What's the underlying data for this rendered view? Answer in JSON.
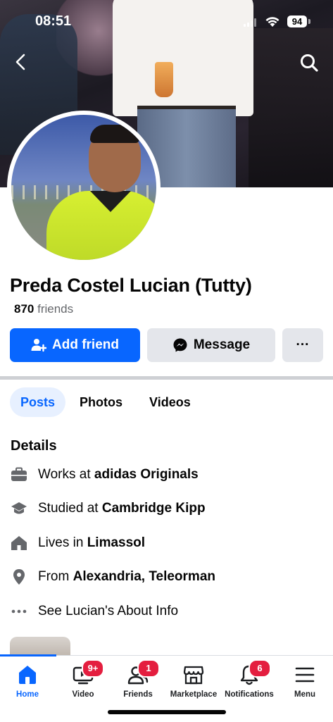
{
  "status_bar": {
    "time": "08:51",
    "battery": "94"
  },
  "profile": {
    "name": "Preda Costel Lucian (Tutty)",
    "friend_count": "870",
    "friends_label": "friends"
  },
  "actions": {
    "add_friend": "Add friend",
    "message": "Message",
    "more": "···"
  },
  "tabs": [
    {
      "label": "Posts",
      "active": true
    },
    {
      "label": "Photos",
      "active": false
    },
    {
      "label": "Videos",
      "active": false
    }
  ],
  "details": {
    "title": "Details",
    "rows": [
      {
        "icon": "briefcase-icon",
        "prefix": "Works at ",
        "bold": "adidas Originals"
      },
      {
        "icon": "graduation-cap-icon",
        "prefix": "Studied at ",
        "bold": "Cambridge Kipp"
      },
      {
        "icon": "home-icon",
        "prefix": "Lives in ",
        "bold": "Limassol"
      },
      {
        "icon": "location-pin-icon",
        "prefix": "From ",
        "bold": "Alexandria, Teleorman"
      },
      {
        "icon": "ellipsis-icon",
        "prefix": "See Lucian's About Info",
        "bold": ""
      }
    ]
  },
  "bottom_nav": [
    {
      "label": "Home",
      "icon": "home-icon",
      "active": true,
      "badge": ""
    },
    {
      "label": "Video",
      "icon": "video-icon",
      "active": false,
      "badge": "9+"
    },
    {
      "label": "Friends",
      "icon": "friends-icon",
      "active": false,
      "badge": "1"
    },
    {
      "label": "Marketplace",
      "icon": "marketplace-icon",
      "active": false,
      "badge": ""
    },
    {
      "label": "Notifications",
      "icon": "bell-icon",
      "active": false,
      "badge": "6"
    },
    {
      "label": "Menu",
      "icon": "menu-icon",
      "active": false,
      "badge": ""
    }
  ],
  "colors": {
    "accent": "#0866ff",
    "badge": "#e41e3f",
    "secondary_button": "#e4e6eb"
  }
}
